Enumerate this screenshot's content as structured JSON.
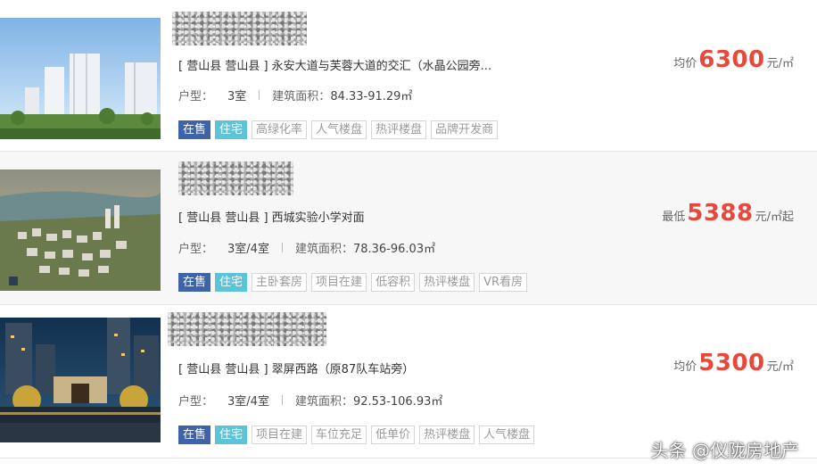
{
  "listings": [
    {
      "address": "[ 营山县 营山县 ] 永安大道与芙蓉大道的交汇（水晶公园旁...",
      "layout_label": "户型：",
      "layout_value": "3室",
      "area_label": "建筑面积：",
      "area_value": "84.33-91.29㎡",
      "tags": [
        "在售",
        "住宅",
        "高绿化率",
        "人气楼盘",
        "热评楼盘",
        "品牌开发商"
      ],
      "price_prefix": "均价",
      "price_value": "6300",
      "price_unit": "元/㎡"
    },
    {
      "address": "[ 营山县 营山县 ] 西城实验小学对面",
      "layout_label": "户型：",
      "layout_value": "3室/4室",
      "area_label": "建筑面积：",
      "area_value": "78.36-96.03㎡",
      "tags": [
        "在售",
        "住宅",
        "主卧套房",
        "项目在建",
        "低容积",
        "热评楼盘",
        "VR看房"
      ],
      "price_prefix": "最低",
      "price_value": "5388",
      "price_unit": "元/㎡起"
    },
    {
      "address": "[ 营山县 营山县 ] 翠屏西路（原87队车站旁）",
      "layout_label": "户型：",
      "layout_value": "3室/4室",
      "area_label": "建筑面积：",
      "area_value": "92.53-106.93㎡",
      "tags": [
        "在售",
        "住宅",
        "项目在建",
        "车位充足",
        "低单价",
        "热评楼盘",
        "人气楼盘"
      ],
      "price_prefix": "均价",
      "price_value": "5300",
      "price_unit": "元/㎡"
    }
  ],
  "watermark": "头条 @仪陇房地产",
  "colors": {
    "price_red": "#e8483b",
    "tag_sale_bg": "#3f63a8",
    "tag_type_bg": "#5bc4d9",
    "tag_gray_text": "#9a9a9a"
  }
}
